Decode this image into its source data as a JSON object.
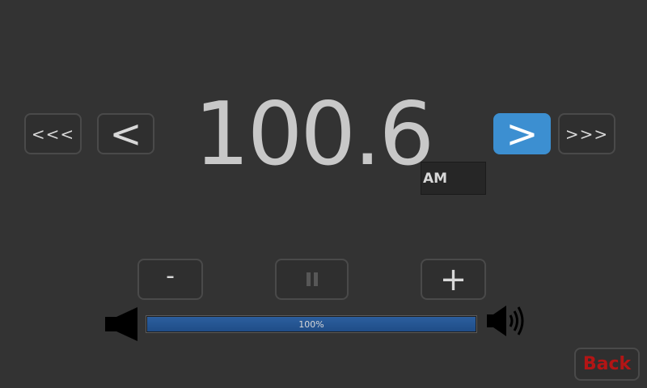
{
  "tuner": {
    "seek_back_label": "<<<",
    "step_back_label": "<",
    "frequency": "100.6",
    "band": "AM",
    "step_forward_label": ">",
    "seek_forward_label": ">>>"
  },
  "controls": {
    "volume_down_label": "-",
    "volume_up_label": "+",
    "pause_icon": "pause-icon"
  },
  "volume": {
    "level_percent": 100,
    "label": "100%"
  },
  "footer": {
    "back_label": "Back"
  },
  "colors": {
    "background": "#333333",
    "accent": "#3c8fd1",
    "volume_fill": "#1f4d87",
    "back_text": "#b31515"
  }
}
